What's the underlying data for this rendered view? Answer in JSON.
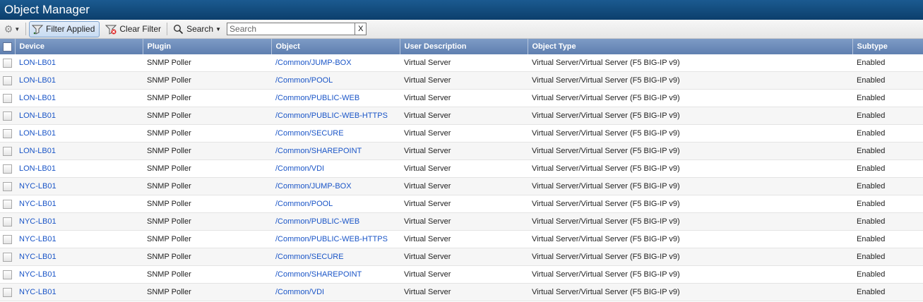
{
  "window": {
    "title": "Object Manager"
  },
  "toolbar": {
    "filter_applied_label": "Filter Applied",
    "clear_filter_label": "Clear Filter",
    "search_label": "Search",
    "search_placeholder": "Search",
    "clear_search_label": "X"
  },
  "table": {
    "columns": [
      "Device",
      "Plugin",
      "Object",
      "User Description",
      "Object Type",
      "Subtype"
    ],
    "rows": [
      {
        "device": "LON-LB01",
        "plugin": "SNMP Poller",
        "object": "/Common/JUMP-BOX",
        "user_description": "Virtual Server",
        "object_type": "Virtual Server/Virtual Server (F5 BIG-IP v9)",
        "subtype": "Enabled"
      },
      {
        "device": "LON-LB01",
        "plugin": "SNMP Poller",
        "object": "/Common/POOL",
        "user_description": "Virtual Server",
        "object_type": "Virtual Server/Virtual Server (F5 BIG-IP v9)",
        "subtype": "Enabled"
      },
      {
        "device": "LON-LB01",
        "plugin": "SNMP Poller",
        "object": "/Common/PUBLIC-WEB",
        "user_description": "Virtual Server",
        "object_type": "Virtual Server/Virtual Server (F5 BIG-IP v9)",
        "subtype": "Enabled"
      },
      {
        "device": "LON-LB01",
        "plugin": "SNMP Poller",
        "object": "/Common/PUBLIC-WEB-HTTPS",
        "user_description": "Virtual Server",
        "object_type": "Virtual Server/Virtual Server (F5 BIG-IP v9)",
        "subtype": "Enabled"
      },
      {
        "device": "LON-LB01",
        "plugin": "SNMP Poller",
        "object": "/Common/SECURE",
        "user_description": "Virtual Server",
        "object_type": "Virtual Server/Virtual Server (F5 BIG-IP v9)",
        "subtype": "Enabled"
      },
      {
        "device": "LON-LB01",
        "plugin": "SNMP Poller",
        "object": "/Common/SHAREPOINT",
        "user_description": "Virtual Server",
        "object_type": "Virtual Server/Virtual Server (F5 BIG-IP v9)",
        "subtype": "Enabled"
      },
      {
        "device": "LON-LB01",
        "plugin": "SNMP Poller",
        "object": "/Common/VDI",
        "user_description": "Virtual Server",
        "object_type": "Virtual Server/Virtual Server (F5 BIG-IP v9)",
        "subtype": "Enabled"
      },
      {
        "device": "NYC-LB01",
        "plugin": "SNMP Poller",
        "object": "/Common/JUMP-BOX",
        "user_description": "Virtual Server",
        "object_type": "Virtual Server/Virtual Server (F5 BIG-IP v9)",
        "subtype": "Enabled"
      },
      {
        "device": "NYC-LB01",
        "plugin": "SNMP Poller",
        "object": "/Common/POOL",
        "user_description": "Virtual Server",
        "object_type": "Virtual Server/Virtual Server (F5 BIG-IP v9)",
        "subtype": "Enabled"
      },
      {
        "device": "NYC-LB01",
        "plugin": "SNMP Poller",
        "object": "/Common/PUBLIC-WEB",
        "user_description": "Virtual Server",
        "object_type": "Virtual Server/Virtual Server (F5 BIG-IP v9)",
        "subtype": "Enabled"
      },
      {
        "device": "NYC-LB01",
        "plugin": "SNMP Poller",
        "object": "/Common/PUBLIC-WEB-HTTPS",
        "user_description": "Virtual Server",
        "object_type": "Virtual Server/Virtual Server (F5 BIG-IP v9)",
        "subtype": "Enabled"
      },
      {
        "device": "NYC-LB01",
        "plugin": "SNMP Poller",
        "object": "/Common/SECURE",
        "user_description": "Virtual Server",
        "object_type": "Virtual Server/Virtual Server (F5 BIG-IP v9)",
        "subtype": "Enabled"
      },
      {
        "device": "NYC-LB01",
        "plugin": "SNMP Poller",
        "object": "/Common/SHAREPOINT",
        "user_description": "Virtual Server",
        "object_type": "Virtual Server/Virtual Server (F5 BIG-IP v9)",
        "subtype": "Enabled"
      },
      {
        "device": "NYC-LB01",
        "plugin": "SNMP Poller",
        "object": "/Common/VDI",
        "user_description": "Virtual Server",
        "object_type": "Virtual Server/Virtual Server (F5 BIG-IP v9)",
        "subtype": "Enabled"
      }
    ]
  },
  "icons": {
    "settings": "gear-icon",
    "filter_applied": "funnel-icon",
    "clear_filter": "funnel-clear-icon",
    "search": "magnifier-icon"
  },
  "colors": {
    "title_bar": "#0c3f6c",
    "header": "#6a88b8",
    "link": "#1a55c7",
    "filter_active_bg": "#c7dbf2"
  }
}
